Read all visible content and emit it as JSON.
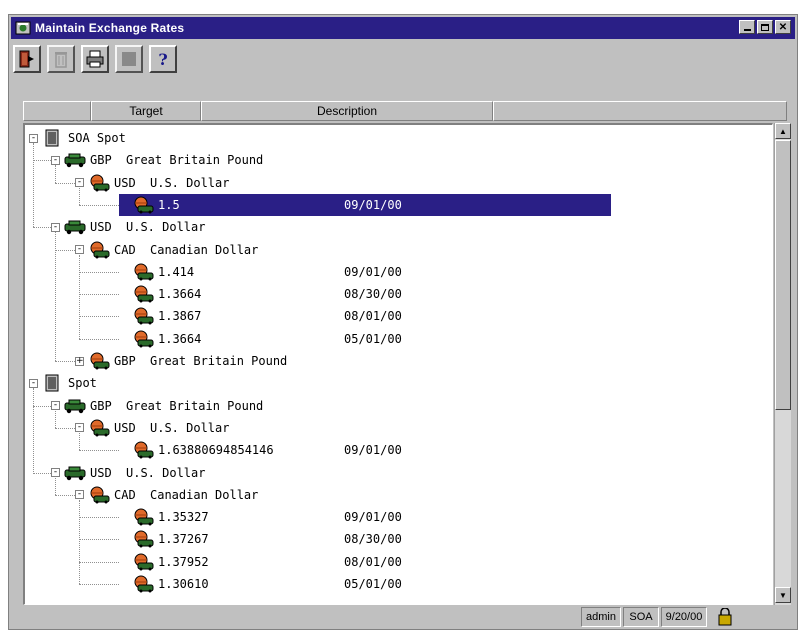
{
  "window": {
    "title": "Maintain Exchange Rates"
  },
  "toolbar": {
    "buttons": [
      {
        "name": "exit-icon"
      },
      {
        "name": "delete-icon"
      },
      {
        "name": "print-icon"
      },
      {
        "name": "stop-icon"
      },
      {
        "name": "help-icon",
        "label": "?"
      }
    ]
  },
  "columns": [
    "",
    "Target",
    "Description",
    ""
  ],
  "tree": {
    "groups": [
      {
        "label": "SOA Spot",
        "currencies": [
          {
            "code": "GBP",
            "desc": "Great Britain Pound",
            "targets": [
              {
                "code": "USD",
                "desc": "U.S. Dollar",
                "rates": [
                  {
                    "rate": "1.5",
                    "date": "09/01/00",
                    "selected": true
                  }
                ]
              }
            ]
          },
          {
            "code": "USD",
            "desc": "U.S. Dollar",
            "targets": [
              {
                "code": "CAD",
                "desc": "Canadian Dollar",
                "rates": [
                  {
                    "rate": "1.414",
                    "date": "09/01/00"
                  },
                  {
                    "rate": "1.3664",
                    "date": "08/30/00"
                  },
                  {
                    "rate": "1.3867",
                    "date": "08/01/00"
                  },
                  {
                    "rate": "1.3664",
                    "date": "05/01/00"
                  }
                ]
              },
              {
                "code": "GBP",
                "desc": "Great Britain Pound",
                "collapsed": true,
                "rates": []
              }
            ]
          }
        ]
      },
      {
        "label": "Spot",
        "currencies": [
          {
            "code": "GBP",
            "desc": "Great Britain Pound",
            "targets": [
              {
                "code": "USD",
                "desc": "U.S. Dollar",
                "rates": [
                  {
                    "rate": "1.63880694854146",
                    "date": "09/01/00"
                  }
                ]
              }
            ]
          },
          {
            "code": "USD",
            "desc": "U.S. Dollar",
            "targets": [
              {
                "code": "CAD",
                "desc": "Canadian Dollar",
                "rates": [
                  {
                    "rate": "1.35327",
                    "date": "09/01/00"
                  },
                  {
                    "rate": "1.37267",
                    "date": "08/30/00"
                  },
                  {
                    "rate": "1.37952",
                    "date": "08/01/00"
                  },
                  {
                    "rate": "1.30610",
                    "date": "05/01/00"
                  }
                ]
              }
            ]
          }
        ]
      }
    ]
  },
  "statusbar": {
    "user": "admin",
    "org": "SOA",
    "date": "9/20/00"
  }
}
